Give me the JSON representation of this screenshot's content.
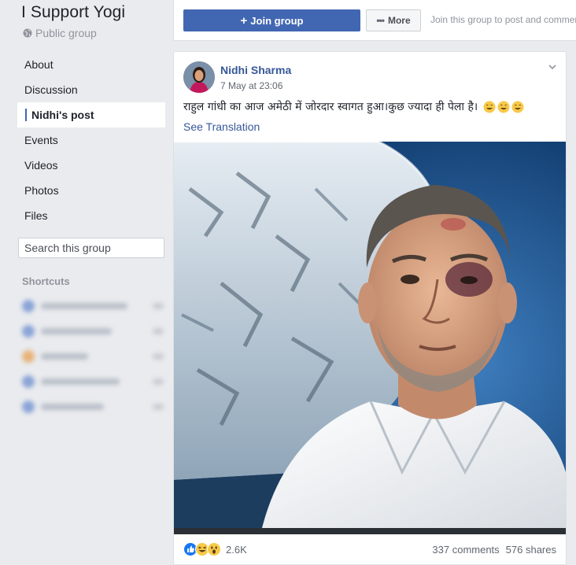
{
  "group": {
    "title": "I Support Yogi",
    "privacy": "Public group"
  },
  "sidebar": {
    "items": [
      {
        "label": "About"
      },
      {
        "label": "Discussion"
      },
      {
        "label": "Nidhi's post"
      },
      {
        "label": "Events"
      },
      {
        "label": "Videos"
      },
      {
        "label": "Photos"
      },
      {
        "label": "Files"
      }
    ],
    "search_placeholder": "Search this group",
    "shortcuts_heading": "Shortcuts"
  },
  "action_bar": {
    "join_label": "Join group",
    "more_label": "More",
    "hint": "Join this group to post and commer"
  },
  "post": {
    "author": "Nidhi Sharma",
    "timestamp": "7 May at 23:06",
    "text": "राहुल गांधी का आज अमेठी में जोरदार स्वागत हुआ।कुछ ज्यादा ही पेला है।",
    "see_translation": "See Translation",
    "reaction_count": "2.6K",
    "comments": "337 comments",
    "shares": "576 shares"
  },
  "colors": {
    "brand": "#4267b2",
    "link": "#365899",
    "background": "#e9ebee"
  }
}
